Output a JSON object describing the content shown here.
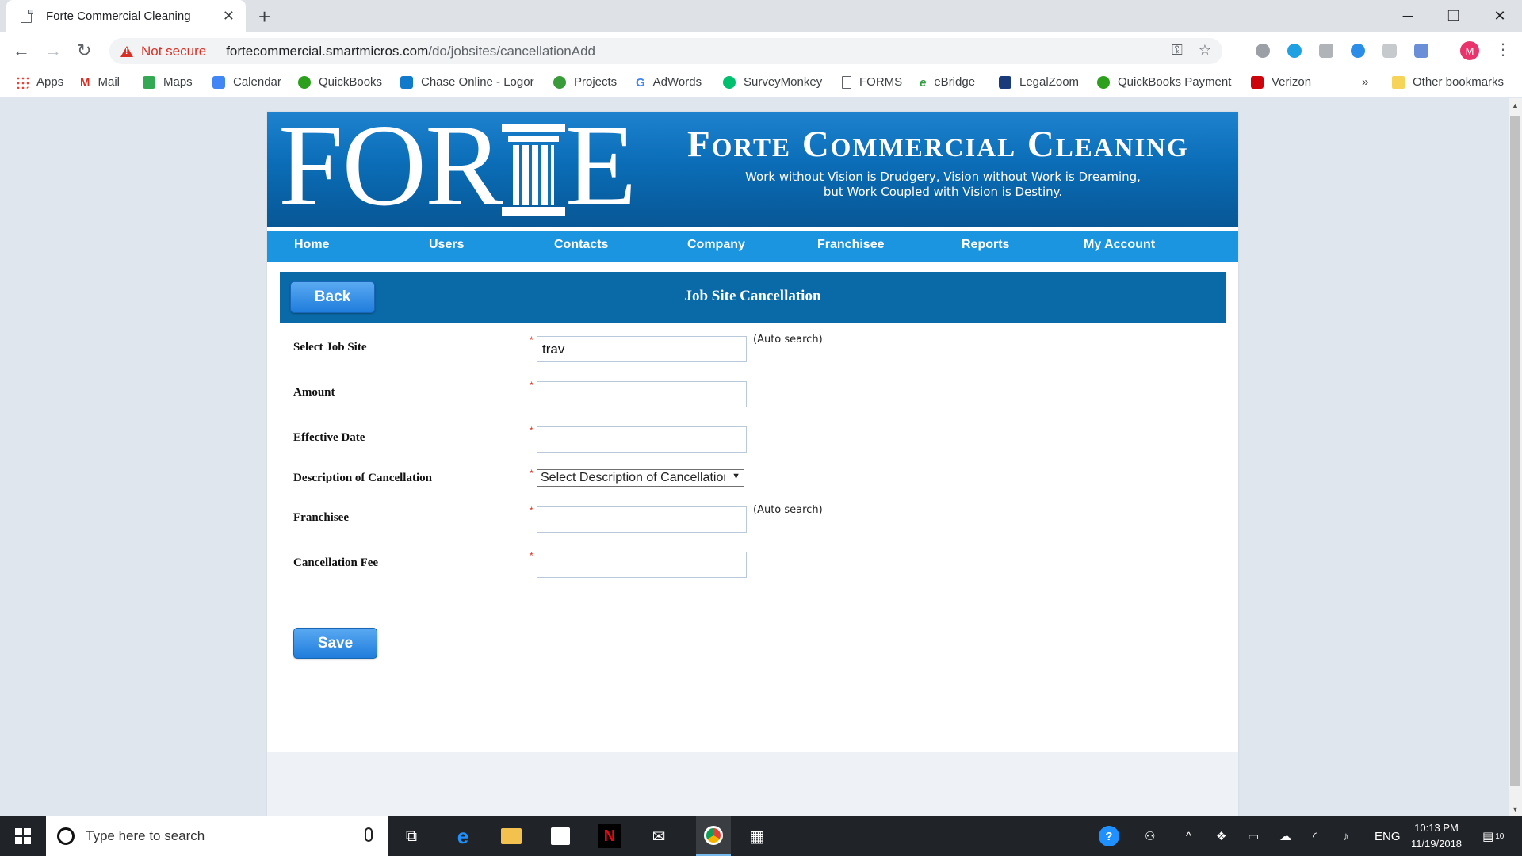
{
  "browser": {
    "tab_title": "Forte Commercial Cleaning",
    "not_secure": "Not secure",
    "url_host": "fortecommercial.smartmicros.com",
    "url_path": "/do/jobsites/cancellationAdd",
    "avatar_letter": "M",
    "bookmarks": [
      {
        "label": "Apps",
        "color": "#ea4335"
      },
      {
        "label": "Mail",
        "color": "#d93025"
      },
      {
        "label": "Maps",
        "color": "#34a853"
      },
      {
        "label": "Calendar",
        "color": "#4285f4"
      },
      {
        "label": "QuickBooks",
        "color": "#2ca01c"
      },
      {
        "label": "Chase Online - Logor",
        "color": "#117aca"
      },
      {
        "label": "Projects",
        "color": "#3a9b3a"
      },
      {
        "label": "AdWords",
        "color": "#4285f4"
      },
      {
        "label": "SurveyMonkey",
        "color": "#00bf6f"
      },
      {
        "label": "FORMS",
        "color": "#5f6368"
      },
      {
        "label": "eBridge",
        "color": "#2e9c3f"
      },
      {
        "label": "LegalZoom",
        "color": "#1b3a7a"
      },
      {
        "label": "QuickBooks Payment",
        "color": "#2ca01c"
      },
      {
        "label": "Verizon",
        "color": "#cd040b"
      }
    ],
    "more_bookmarks": "»",
    "other_bookmarks": "Other bookmarks"
  },
  "banner": {
    "logo_left": "FOR",
    "logo_right": "E",
    "company_name": "Forte Commercial Cleaning",
    "tagline_line1": "Work without Vision is Drudgery, Vision without Work is Dreaming,",
    "tagline_line2": "but Work Coupled with Vision is Destiny."
  },
  "nav": [
    "Home",
    "Users",
    "Contacts",
    "Company",
    "Franchisee",
    "Reports",
    "My Account"
  ],
  "header": {
    "back_label": "Back",
    "title": "Job Site Cancellation"
  },
  "form": {
    "required_mark": "*",
    "auto_search": "(Auto search)",
    "job_site": {
      "label": "Select Job Site",
      "value": "trav"
    },
    "amount": {
      "label": "Amount",
      "value": ""
    },
    "effective_date": {
      "label": "Effective Date",
      "value": ""
    },
    "description": {
      "label": "Description of Cancellation",
      "selected": "Select Description of Cancellation"
    },
    "franchisee": {
      "label": "Franchisee",
      "value": ""
    },
    "cancellation_fee": {
      "label": "Cancellation Fee",
      "value": ""
    },
    "save_label": "Save"
  },
  "taskbar": {
    "search_placeholder": "Type here to search",
    "lang": "ENG",
    "time": "10:13 PM",
    "date": "11/19/2018",
    "notifications": "10"
  },
  "colors": {
    "banner": "#0b6db7",
    "nav": "#1b95e0",
    "header_bar": "#0a6aa8",
    "button": "#1f7ddc",
    "required": "#d93025"
  }
}
